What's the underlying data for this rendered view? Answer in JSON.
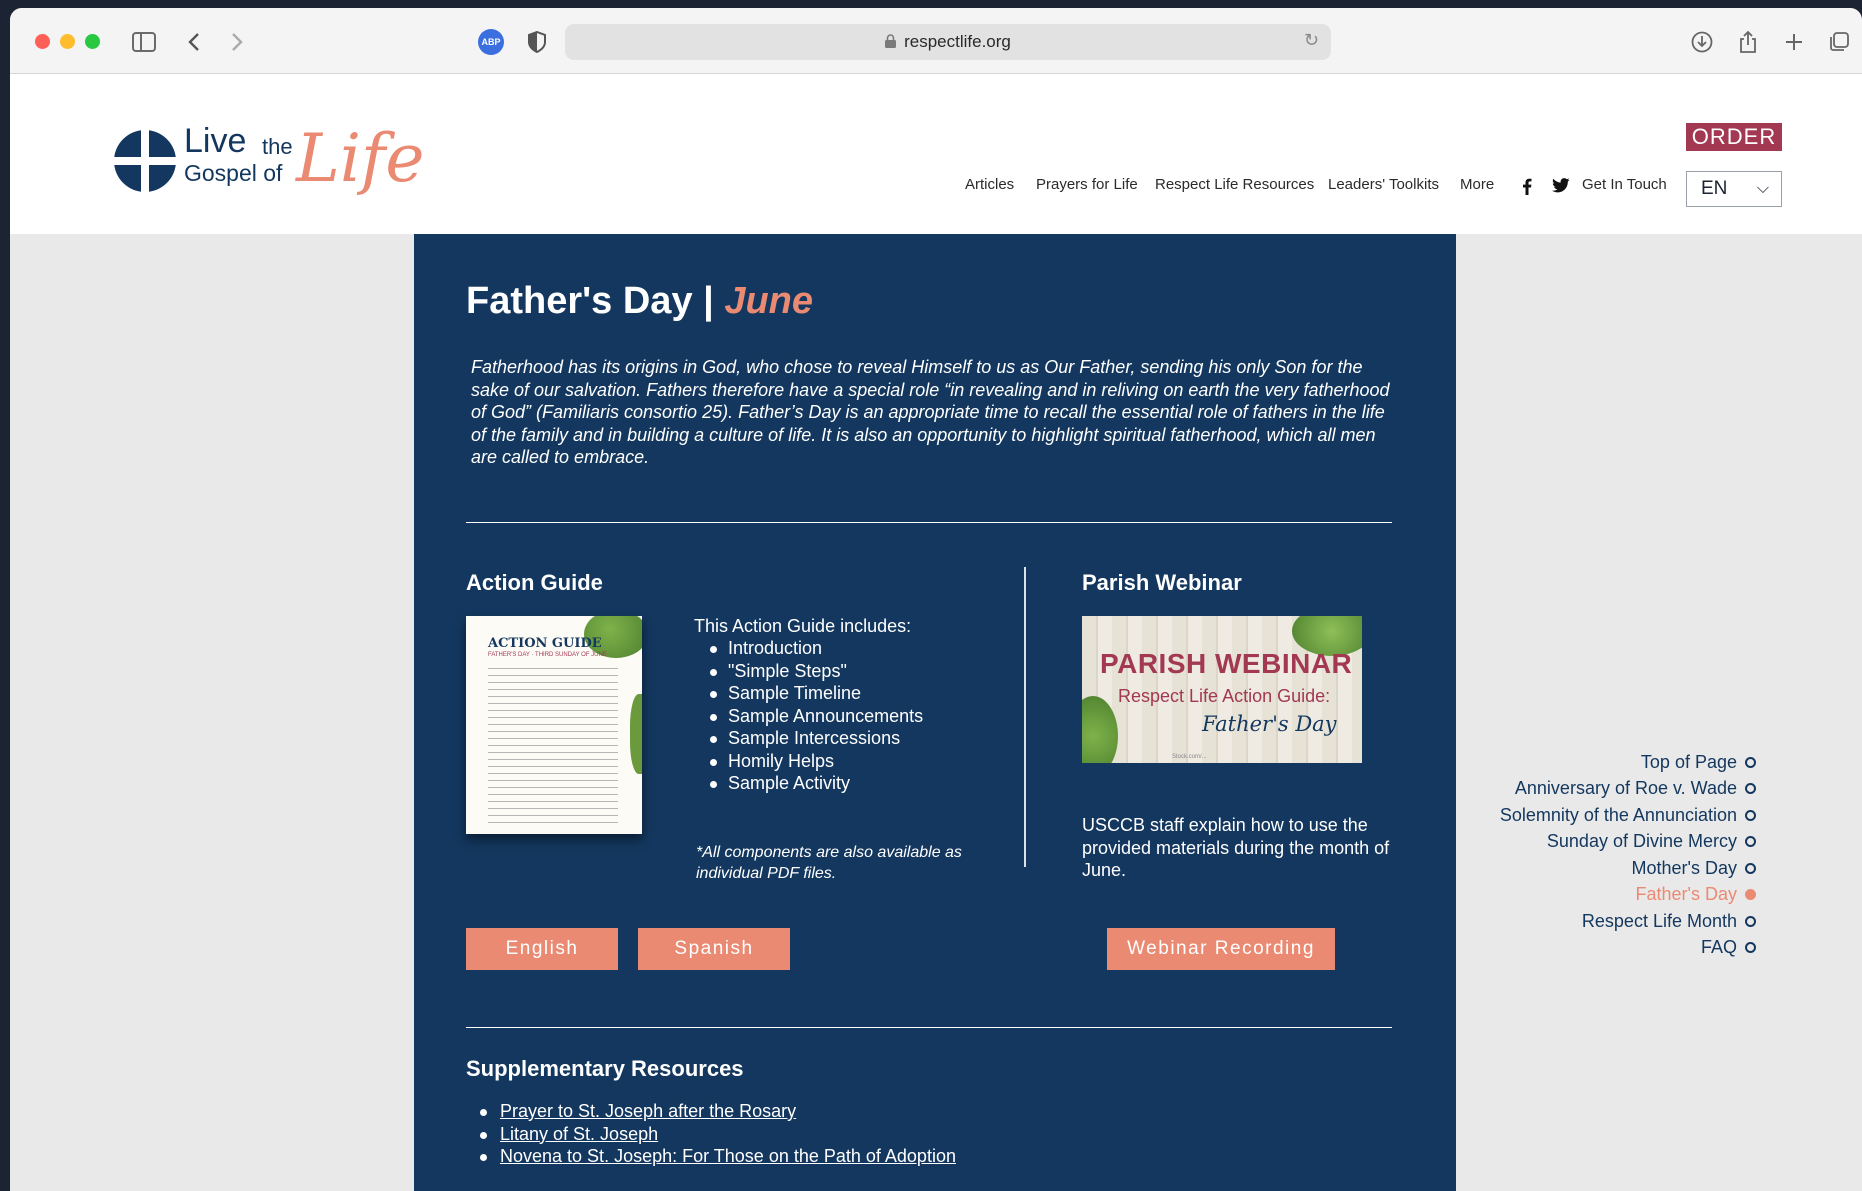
{
  "browser": {
    "url": "respectlife.org",
    "abp_label": "ABP"
  },
  "logo": {
    "live": "Live",
    "the": "the",
    "gospel_of": "Gospel of",
    "life": "Life"
  },
  "header": {
    "order_label": "ORDER",
    "language": "EN",
    "nav": [
      "Articles",
      "Prayers for Life",
      "Respect Life Resources",
      "Leaders' Toolkits",
      "More"
    ],
    "get_in_touch": "Get In Touch"
  },
  "main": {
    "title": "Father's Day | ",
    "title_month": "June",
    "intro": "Fatherhood has its origins in God, who chose to reveal Himself to us as Our Father, sending his only Son for the sake of our salvation. Fathers therefore have a special role “in revealing and in reliving on earth the very fatherhood of God” (Familiaris consortio 25). Father’s Day is an appropriate time to recall the essential role of fathers in the life of the family and in building a culture of life. It is also an opportunity to highlight spiritual fatherhood, which all men are called to embrace.",
    "action_guide": {
      "heading": "Action Guide",
      "thumb_title": "ACTION GUIDE",
      "thumb_subtitle": "FATHER'S DAY · THIRD SUNDAY OF JUNE",
      "includes_label": "This Action Guide includes:",
      "items": [
        "Introduction",
        "\"Simple Steps\"",
        "Sample Timeline",
        "Sample Announcements",
        "Sample Intercessions",
        "Homily Helps",
        "Sample Activity"
      ],
      "pdf_note": "*All components are also available as individual PDF files.",
      "english_button": "English",
      "spanish_button": "Spanish"
    },
    "webinar": {
      "heading": "Parish Webinar",
      "thumb_title": "PARISH WEBINAR",
      "thumb_subtitle": "Respect Life Action Guide:",
      "thumb_fathers_day": "Father's Day",
      "thumb_credit": "Stock.com/...",
      "description": "USCCB staff explain how to use the provided materials during the month of June.",
      "button": "Webinar Recording"
    },
    "supplementary": {
      "heading": "Supplementary Resources",
      "links": [
        "Prayer to St. Joseph after the Rosary",
        "Litany of St. Joseph",
        "Novena to St. Joseph: For Those on the Path of Adoption"
      ]
    }
  },
  "sidenav": {
    "items": [
      {
        "label": "Top of Page",
        "active": false
      },
      {
        "label": "Anniversary of Roe v. Wade",
        "active": false
      },
      {
        "label": "Solemnity of the Annunciation",
        "active": false
      },
      {
        "label": "Sunday of Divine Mercy",
        "active": false
      },
      {
        "label": "Mother's Day",
        "active": false
      },
      {
        "label": "Father's Day",
        "active": true
      },
      {
        "label": "Respect Life Month",
        "active": false
      },
      {
        "label": "FAQ",
        "active": false
      }
    ]
  },
  "colors": {
    "navy": "#13375e",
    "salmon": "#ea8a72",
    "order_red": "#a23851"
  }
}
